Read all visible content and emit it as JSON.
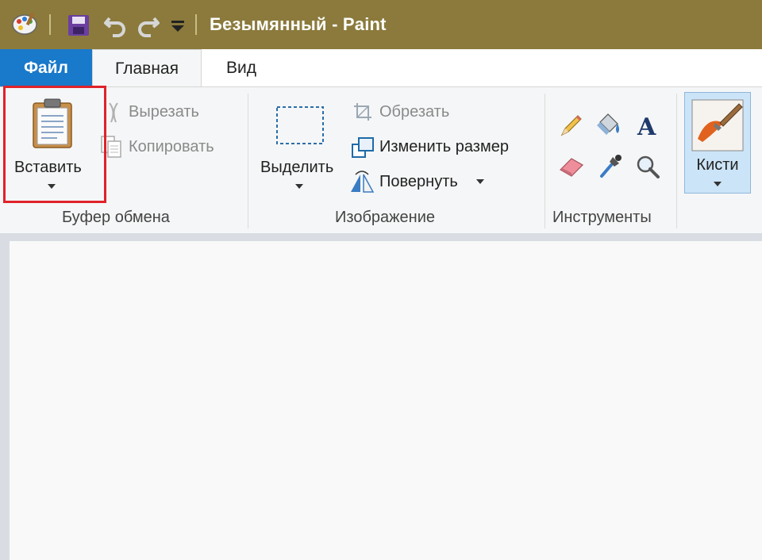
{
  "window": {
    "title": "Безымянный - Paint"
  },
  "quick_access": {
    "icons": [
      "paint-app-icon",
      "save-icon",
      "undo-icon",
      "redo-icon",
      "customize-dropdown-icon"
    ]
  },
  "tabs": {
    "file": "Файл",
    "home": "Главная",
    "view": "Вид"
  },
  "clipboard": {
    "paste": "Вставить",
    "cut": "Вырезать",
    "copy": "Копировать",
    "group_label": "Буфер обмена"
  },
  "image": {
    "select": "Выделить",
    "crop": "Обрезать",
    "resize": "Изменить размер",
    "rotate": "Повернуть",
    "group_label": "Изображение"
  },
  "tools": {
    "group_label": "Инструменты",
    "icons": [
      "pencil-icon",
      "fill-bucket-icon",
      "text-icon",
      "eraser-icon",
      "color-picker-icon",
      "magnifier-icon"
    ]
  },
  "brushes": {
    "label": "Кисти"
  },
  "colors": {
    "titlebar": "#8b7a3c",
    "file_tab": "#1979ca",
    "highlight": "#e0222a"
  }
}
